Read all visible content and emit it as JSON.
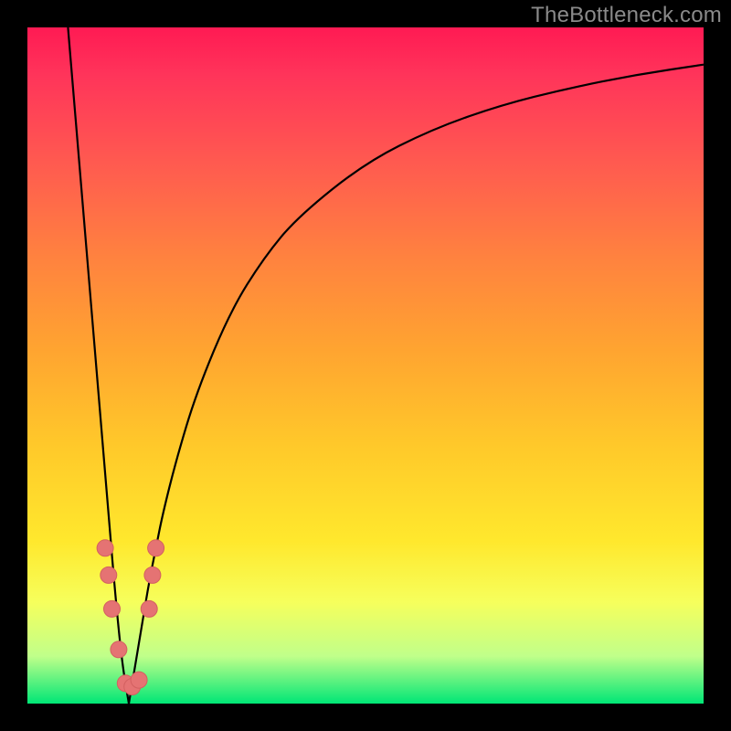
{
  "watermark": "TheBottleneck.com",
  "colors": {
    "curve": "#000000",
    "marker_fill": "#e57373",
    "marker_stroke": "#d36060",
    "background_black": "#000000"
  },
  "chart_data": {
    "type": "line",
    "title": "",
    "xlabel": "",
    "ylabel": "",
    "xlim": [
      0,
      100
    ],
    "ylim": [
      0,
      100
    ],
    "grid": false,
    "legend": false,
    "note": "V-shaped bottleneck curve. Left branch steep descent from top to x≈15 at y≈0. Right branch rises asymptotically toward upper right. Y represents bottleneck percentage (lower is better, green zone at bottom).",
    "series": [
      {
        "name": "left_branch",
        "x": [
          6,
          7,
          8,
          9,
          10,
          11,
          12,
          13,
          14,
          15
        ],
        "y": [
          100,
          88,
          76,
          64,
          52,
          40,
          28,
          16,
          6,
          0
        ]
      },
      {
        "name": "right_branch",
        "x": [
          15,
          16,
          17,
          18,
          19,
          20,
          22,
          25,
          30,
          35,
          40,
          50,
          60,
          70,
          80,
          90,
          100
        ],
        "y": [
          0,
          6,
          12,
          18,
          23,
          28,
          36,
          46,
          58,
          66,
          72,
          80,
          85,
          88.5,
          91,
          93,
          94.5
        ]
      }
    ],
    "markers": {
      "name": "highlighted_points",
      "note": "Pink circular markers near the minimum of the curve (low bottleneck zone)",
      "points": [
        {
          "x": 11.5,
          "y": 23
        },
        {
          "x": 12.0,
          "y": 19
        },
        {
          "x": 12.5,
          "y": 14
        },
        {
          "x": 13.5,
          "y": 8
        },
        {
          "x": 14.5,
          "y": 3
        },
        {
          "x": 15.5,
          "y": 2.5
        },
        {
          "x": 16.5,
          "y": 3.5
        },
        {
          "x": 18.0,
          "y": 14
        },
        {
          "x": 18.5,
          "y": 19
        },
        {
          "x": 19.0,
          "y": 23
        }
      ]
    }
  }
}
